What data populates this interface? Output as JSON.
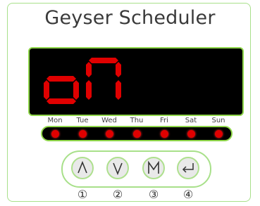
{
  "app": {
    "title": "Geyser Scheduler"
  },
  "display": {
    "text": "on",
    "segment_color": "#e00000"
  },
  "days": [
    {
      "label": "Mon",
      "led_on": true
    },
    {
      "label": "Tue",
      "led_on": true
    },
    {
      "label": "Wed",
      "led_on": true
    },
    {
      "label": "Thu",
      "led_on": true
    },
    {
      "label": "Fri",
      "led_on": true
    },
    {
      "label": "Sat",
      "led_on": true
    },
    {
      "label": "Sun",
      "led_on": true
    }
  ],
  "buttons": [
    {
      "name": "up-button",
      "icon": "caret-up-icon",
      "number": "①"
    },
    {
      "name": "down-button",
      "icon": "caret-down-icon",
      "number": "②"
    },
    {
      "name": "mode-button",
      "icon": "mode-m-icon",
      "number": "③"
    },
    {
      "name": "enter-button",
      "icon": "enter-return-icon",
      "number": "④"
    }
  ],
  "colors": {
    "accent_green": "#8fd64a",
    "led_red": "#e00000",
    "button_fill": "#e9e9e9"
  }
}
